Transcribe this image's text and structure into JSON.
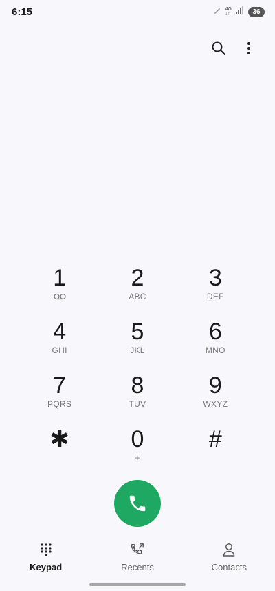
{
  "status_bar": {
    "time": "6:15",
    "network_top": "4G",
    "network_bottom": "↓↑",
    "battery": "36"
  },
  "keypad": {
    "keys": [
      {
        "digit": "1",
        "letters": "",
        "icon": "voicemail-icon"
      },
      {
        "digit": "2",
        "letters": "ABC"
      },
      {
        "digit": "3",
        "letters": "DEF"
      },
      {
        "digit": "4",
        "letters": "GHI"
      },
      {
        "digit": "5",
        "letters": "JKL"
      },
      {
        "digit": "6",
        "letters": "MNO"
      },
      {
        "digit": "7",
        "letters": "PQRS"
      },
      {
        "digit": "8",
        "letters": "TUV"
      },
      {
        "digit": "9",
        "letters": "WXYZ"
      },
      {
        "digit": "✱",
        "letters": ""
      },
      {
        "digit": "0",
        "letters": "+"
      },
      {
        "digit": "#",
        "letters": ""
      }
    ]
  },
  "call_button": {
    "color": "#1fa862",
    "icon": "phone-icon"
  },
  "bottom_nav": {
    "items": [
      {
        "label": "Keypad",
        "icon": "keypad-icon",
        "active": true
      },
      {
        "label": "Recents",
        "icon": "recents-icon",
        "active": false
      },
      {
        "label": "Contacts",
        "icon": "contacts-icon",
        "active": false
      }
    ]
  }
}
